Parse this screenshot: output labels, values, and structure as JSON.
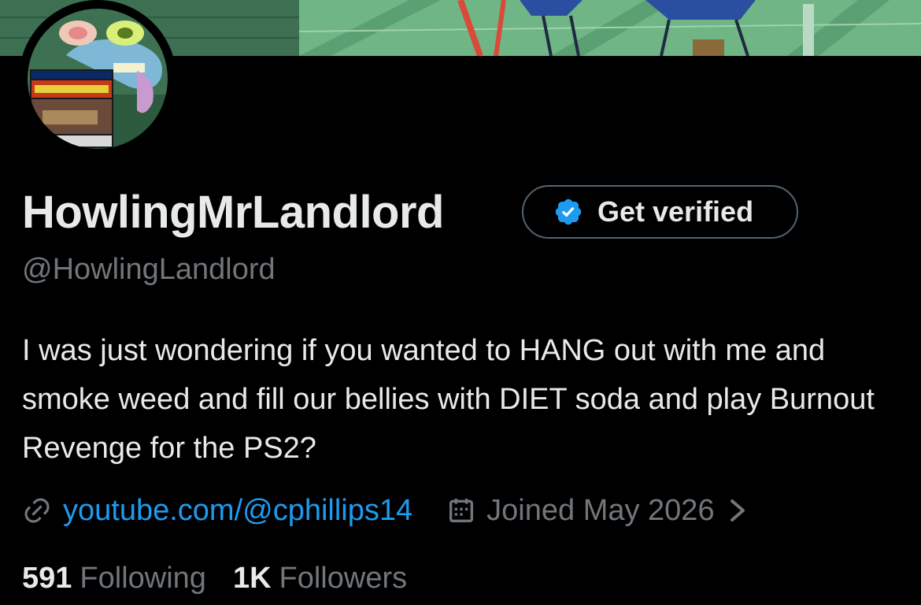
{
  "profile": {
    "display_name": "HowlingMrLandlord",
    "handle": "@HowlingLandlord",
    "bio": "I was just wondering if you wanted to HANG out with me and smoke weed and fill our bellies with DIET soda and play Burnout Revenge for the PS2?",
    "website": "youtube.com/@cphillips14",
    "joined": "Joined May 2026"
  },
  "get_verified": {
    "label": "Get verified"
  },
  "stats": {
    "following_count": "591",
    "following_label": "Following",
    "followers_count": "1K",
    "followers_label": "Followers"
  },
  "icons": {
    "verified": "verified-badge-icon",
    "link": "link-icon",
    "calendar": "calendar-icon",
    "chevron": "chevron-right-icon"
  },
  "colors": {
    "background": "#000000",
    "primary_text": "#e7e9ea",
    "secondary_text": "#71767b",
    "link": "#1d9bf0",
    "verified_blue": "#1d9bf0",
    "button_border": "#536471"
  }
}
